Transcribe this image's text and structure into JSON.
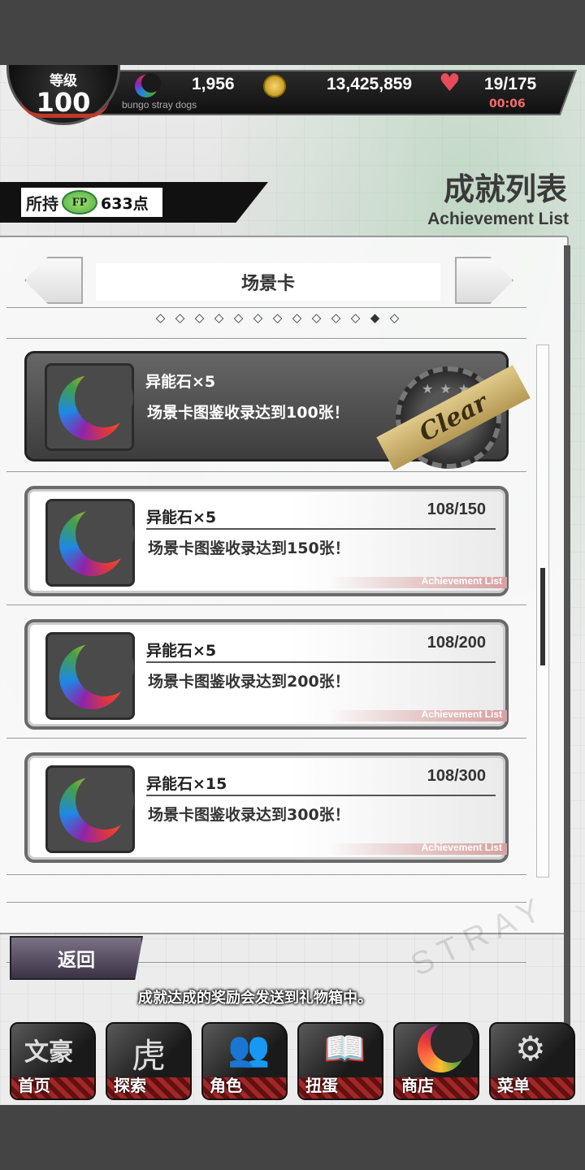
{
  "header": {
    "level_label": "等级",
    "level_value": "100",
    "stones": "1,956",
    "coins": "13,425,859",
    "ap": "19/175",
    "timer": "00:06",
    "subtitle": "bungo stray dogs",
    "heart_badge": "AP"
  },
  "fp": {
    "label": "所持",
    "icon_text": "FP",
    "value": "633点"
  },
  "page": {
    "title": "成就列表",
    "subtitle": "Achievement List"
  },
  "category": {
    "name": "场景卡",
    "page_dots": [
      "◇",
      "◇",
      "◇",
      "◇",
      "◇",
      "◇",
      "◇",
      "◇",
      "◇",
      "◇",
      "◇",
      "◆",
      "◇"
    ]
  },
  "achievements": [
    {
      "reward": "异能石×5",
      "desc": "场景卡图鉴收录达到100张！",
      "progress": "",
      "status": "clear",
      "stamp": "Clear",
      "stars": "★★★"
    },
    {
      "reward": "异能石×5",
      "desc": "场景卡图鉴收录达到150张！",
      "progress": "108/150",
      "status": "open",
      "footer": "Achievement List"
    },
    {
      "reward": "异能石×5",
      "desc": "场景卡图鉴收录达到200张！",
      "progress": "108/200",
      "status": "open",
      "footer": "Achievement List"
    },
    {
      "reward": "异能石×15",
      "desc": "场景卡图鉴收录达到300张！",
      "progress": "108/300",
      "status": "open",
      "footer": "Achievement List"
    }
  ],
  "back_label": "返回",
  "notice": "成就达成的奖励会发送到礼物箱中。",
  "watermark": "STRAY",
  "nav": [
    {
      "label": "首页",
      "icon": "bungo-logo-icon",
      "glyph": "文豪"
    },
    {
      "label": "探索",
      "icon": "tiger-icon",
      "glyph": "虎"
    },
    {
      "label": "角色",
      "icon": "characters-icon",
      "glyph": "👥"
    },
    {
      "label": "扭蛋",
      "icon": "book-icon",
      "glyph": "📖"
    },
    {
      "label": "商店",
      "icon": "stone-icon",
      "glyph": ""
    },
    {
      "label": "菜单",
      "icon": "gear-icon",
      "glyph": "⚙"
    }
  ],
  "colors": {
    "accent_red": "#c0392b",
    "clear_gold": "#d4bb7a"
  }
}
